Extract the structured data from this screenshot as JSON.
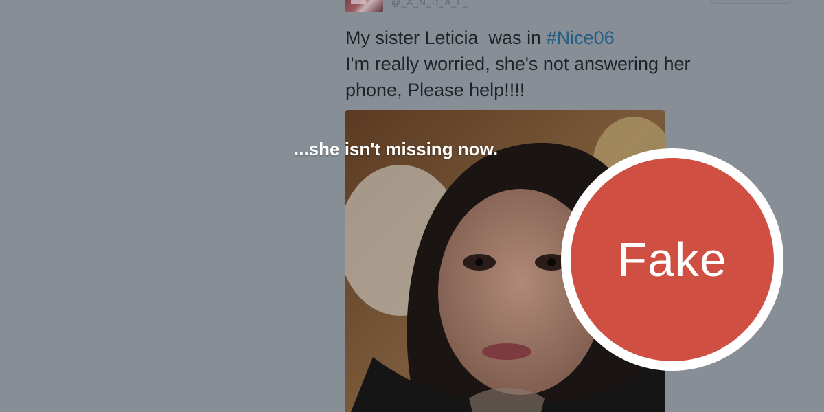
{
  "tweet": {
    "handle": "@_A_N_D_A_L_",
    "text_line1_prefix": "My sister Leticia  was in ",
    "hashtag": "#Nice06",
    "text_line2": "I'm really worried, she's not answering her",
    "text_line3": "phone, Please help!!!!"
  },
  "overlay": {
    "caption": "...she isn't missing now.",
    "verdict": "Fake",
    "verdict_color": "#cf5043"
  },
  "colors": {
    "background": "#878e96",
    "hashtag": "#235e84",
    "text": "#1e2328"
  }
}
